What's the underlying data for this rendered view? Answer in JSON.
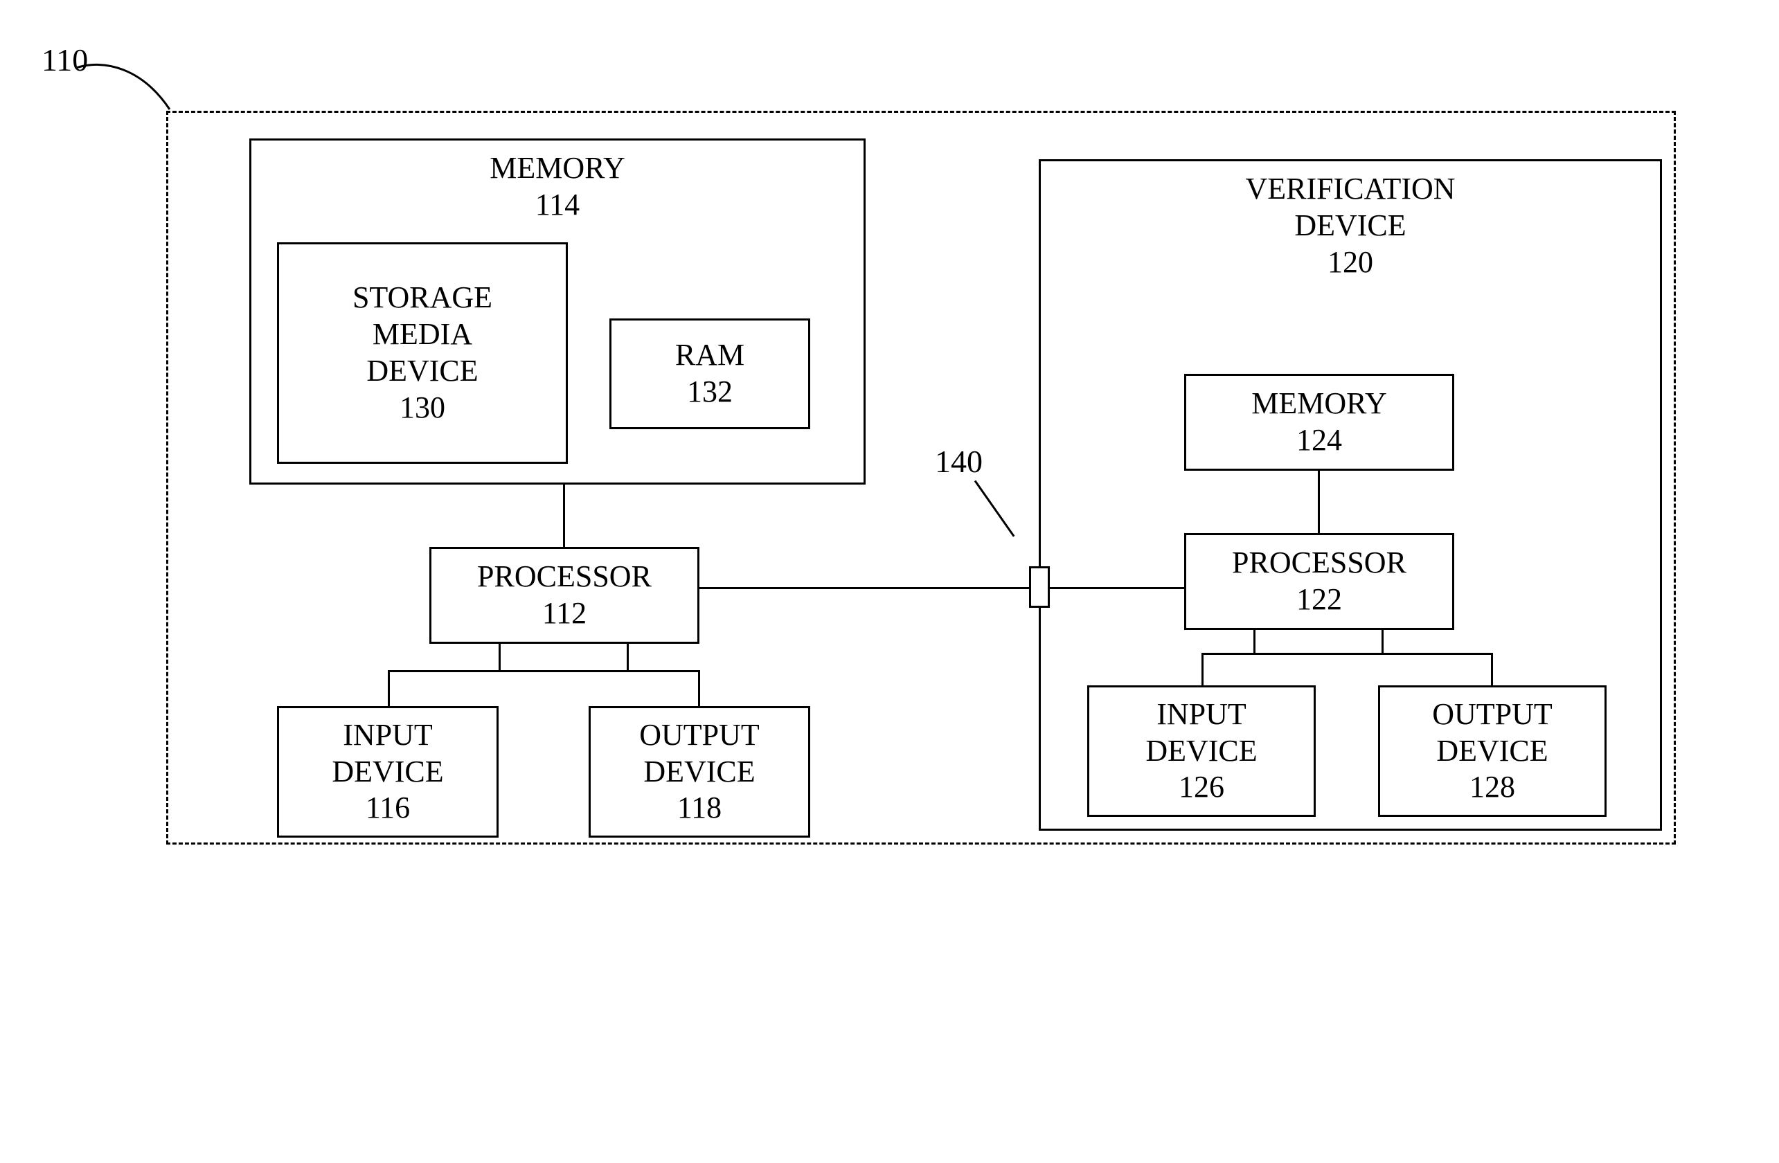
{
  "system": {
    "outer_ref": "110",
    "interconnect_ref": "140",
    "left": {
      "memory": {
        "title": "MEMORY",
        "ref": "114",
        "storage": {
          "title": "STORAGE MEDIA DEVICE",
          "ref": "130"
        },
        "ram": {
          "title": "RAM",
          "ref": "132"
        }
      },
      "processor": {
        "title": "PROCESSOR",
        "ref": "112"
      },
      "input": {
        "title": "INPUT DEVICE",
        "ref": "116"
      },
      "output": {
        "title": "OUTPUT DEVICE",
        "ref": "118"
      }
    },
    "right": {
      "title": "VERIFICATION DEVICE",
      "ref": "120",
      "memory": {
        "title": "MEMORY",
        "ref": "124"
      },
      "processor": {
        "title": "PROCESSOR",
        "ref": "122"
      },
      "input": {
        "title": "INPUT DEVICE",
        "ref": "126"
      },
      "output": {
        "title": "OUTPUT DEVICE",
        "ref": "128"
      }
    }
  }
}
